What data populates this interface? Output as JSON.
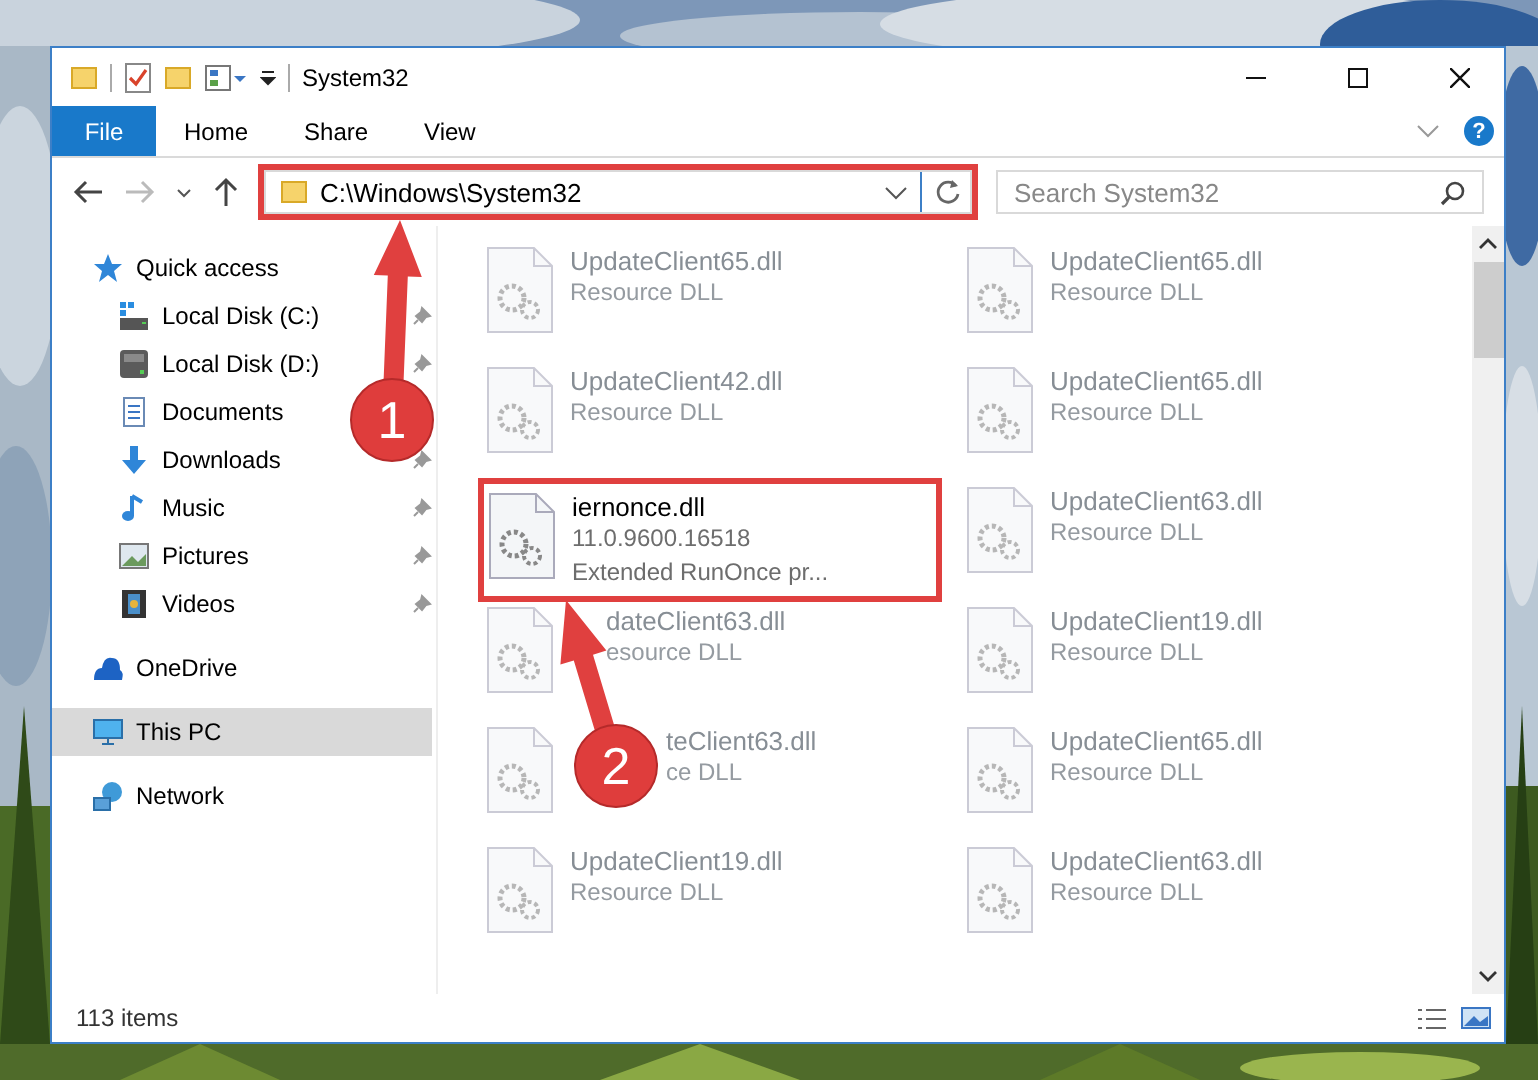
{
  "window": {
    "title": "System32"
  },
  "ribbon": {
    "file_tab": "File",
    "tabs": [
      "Home",
      "Share",
      "View"
    ],
    "help": "?"
  },
  "address": {
    "path": "C:\\Windows\\System32",
    "highlighted": true
  },
  "search": {
    "placeholder": "Search System32"
  },
  "sidebar": {
    "items": [
      {
        "label": "Quick access",
        "kind": "star",
        "selected": false,
        "children": [
          {
            "label": "Local Disk (C:)",
            "kind": "drive-c",
            "pinned": true,
            "selected": false
          },
          {
            "label": "Local Disk (D:)",
            "kind": "drive",
            "pinned": true,
            "selected": false
          },
          {
            "label": "Documents",
            "kind": "documents",
            "selected": false
          },
          {
            "label": "Downloads",
            "kind": "downloads",
            "pinned": true,
            "selected": false
          },
          {
            "label": "Music",
            "kind": "music",
            "pinned": true,
            "selected": false
          },
          {
            "label": "Pictures",
            "kind": "pictures",
            "pinned": true,
            "selected": false
          },
          {
            "label": "Videos",
            "kind": "videos",
            "pinned": true,
            "selected": false
          }
        ]
      },
      {
        "label": "OneDrive",
        "kind": "onedrive",
        "selected": false
      },
      {
        "label": "This PC",
        "kind": "pc",
        "selected": true
      },
      {
        "label": "Network",
        "kind": "network",
        "selected": false
      }
    ]
  },
  "files": [
    {
      "name": "UpdateClient65.dll",
      "lines": [
        "Resource DLL"
      ],
      "blurred": true,
      "highlighted": false,
      "under_arrow": false,
      "under_badge": false
    },
    {
      "name": "UpdateClient65.dll",
      "lines": [
        "Resource DLL"
      ],
      "blurred": true,
      "highlighted": false,
      "under_arrow": false,
      "under_badge": false
    },
    {
      "name": "UpdateClient42.dll",
      "lines": [
        "Resource DLL"
      ],
      "blurred": true,
      "highlighted": false,
      "under_arrow": false,
      "under_badge": false
    },
    {
      "name": "UpdateClient65.dll",
      "lines": [
        "Resource DLL"
      ],
      "blurred": true,
      "highlighted": false,
      "under_arrow": false,
      "under_badge": false
    },
    {
      "name": "iernonce.dll",
      "lines": [
        "11.0.9600.16518",
        "Extended RunOnce pr..."
      ],
      "blurred": false,
      "highlighted": true,
      "under_arrow": false,
      "under_badge": false
    },
    {
      "name": "UpdateClient63.dll",
      "lines": [
        "Resource DLL"
      ],
      "blurred": true,
      "highlighted": false,
      "under_arrow": false,
      "under_badge": false
    },
    {
      "name": "dateClient63.dll",
      "lines": [
        "esource DLL"
      ],
      "blurred": true,
      "highlighted": false,
      "under_arrow": true,
      "under_badge": false
    },
    {
      "name": "UpdateClient19.dll",
      "lines": [
        "Resource DLL"
      ],
      "blurred": true,
      "highlighted": false,
      "under_arrow": false,
      "under_badge": false
    },
    {
      "name": "teClient63.dll",
      "lines": [
        "ce DLL"
      ],
      "blurred": true,
      "highlighted": false,
      "under_arrow": false,
      "under_badge": true
    },
    {
      "name": "UpdateClient65.dll",
      "lines": [
        "Resource DLL"
      ],
      "blurred": true,
      "highlighted": false,
      "under_arrow": false,
      "under_badge": false
    },
    {
      "name": "UpdateClient19.dll",
      "lines": [
        "Resource DLL"
      ],
      "blurred": true,
      "highlighted": false,
      "under_arrow": false,
      "under_badge": false
    },
    {
      "name": "UpdateClient63.dll",
      "lines": [
        "Resource DLL"
      ],
      "blurred": true,
      "highlighted": false,
      "under_arrow": false,
      "under_badge": false
    }
  ],
  "callouts": [
    {
      "number": "1"
    },
    {
      "number": "2"
    }
  ],
  "status_bar": {
    "item_count": "113 items"
  }
}
